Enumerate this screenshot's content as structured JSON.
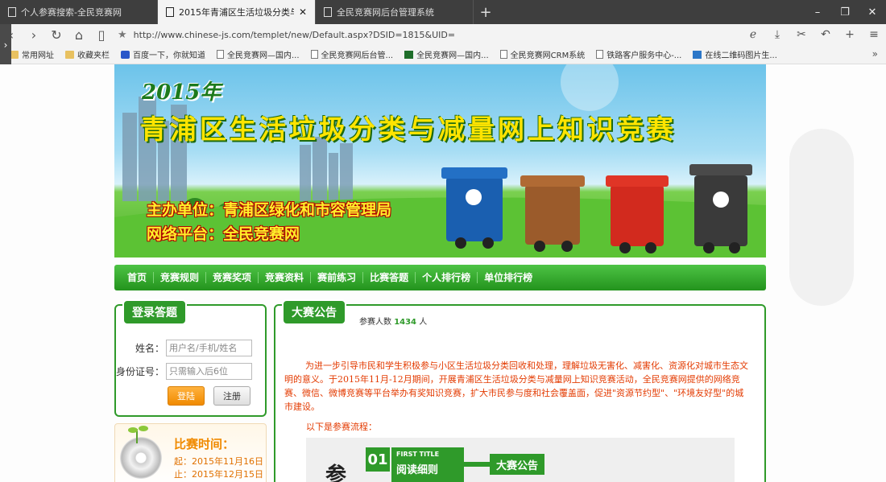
{
  "browser": {
    "tabs": [
      {
        "label": "个人参赛搜索-全民竞赛网",
        "active": false
      },
      {
        "label": "2015年青浦区生活垃圾分类与减量网上知识竞赛",
        "active": true
      },
      {
        "label": "全民竞赛网后台管理系统",
        "active": false
      }
    ],
    "url": "http://www.chinese-js.com/templet/new/Default.aspx?DSID=1815&UID=",
    "bookmarks": [
      {
        "label": "常用网址",
        "icon": "folder-icon"
      },
      {
        "label": "收藏夹栏",
        "icon": "folder-icon"
      },
      {
        "label": "百度一下，你就知道",
        "icon": "baidu-icon"
      },
      {
        "label": "全民竞赛网—国内...",
        "icon": "page-icon"
      },
      {
        "label": "全民竞赛网后台管...",
        "icon": "page-icon"
      },
      {
        "label": "全民竞赛网—国内...",
        "icon": "js-icon"
      },
      {
        "label": "全民竞赛网CRM系统",
        "icon": "page-icon"
      },
      {
        "label": "铁路客户服务中心-...",
        "icon": "page-icon"
      },
      {
        "label": "在线二维码图片生...",
        "icon": "qr-icon"
      }
    ]
  },
  "banner": {
    "year": "2015年",
    "title": "青浦区生活垃圾分类与减量网上知识竞赛",
    "host": "主办单位：青浦区绿化和市容管理局",
    "platform": "网络平台：全民竞赛网"
  },
  "nav": [
    "首页",
    "竞赛规则",
    "竞赛奖项",
    "竞赛资料",
    "赛前练习",
    "比赛答题",
    "个人排行榜",
    "单位排行榜"
  ],
  "login": {
    "title": "登录答题",
    "name_label": "姓名：",
    "name_placeholder": "用户名/手机/姓名",
    "id_label": "身份证号：",
    "id_placeholder": "只需输入后6位",
    "login_btn": "登陆",
    "register_btn": "注册"
  },
  "contest_time": {
    "title": "比赛时间：",
    "start": "起：2015年11月16日",
    "end": "止：2015年12月15日"
  },
  "announcement": {
    "title": "大赛公告",
    "participants_label": "参赛人数",
    "participants_count": "1434",
    "participants_unit": "人",
    "body": "为进一步引导市民和学生积极参与小区生活垃圾分类回收和处理，理解垃圾无害化、减害化、资源化对城市生态文明的意义。于2015年11月-12月期间，开展青浦区生活垃圾分类与减量网上知识竞赛活动，全民竞赛网提供的网络竞赛、微信、微博竞赛等平台举办有奖知识竞赛，扩大市民参与度和社会覆盖面，促进\"资源节约型\"、\"环境友好型\"的城市建设。",
    "flow_intro": "以下是参赛流程：",
    "flow": {
      "big_char": "参",
      "num": "01",
      "first_title": "FIRST TITLE",
      "step_name": "阅读细则",
      "tag": "大赛公告"
    }
  },
  "colors": {
    "primary_green": "#2f9a2a",
    "announcement_text": "#e33a00",
    "login_button": "#f08a00"
  }
}
